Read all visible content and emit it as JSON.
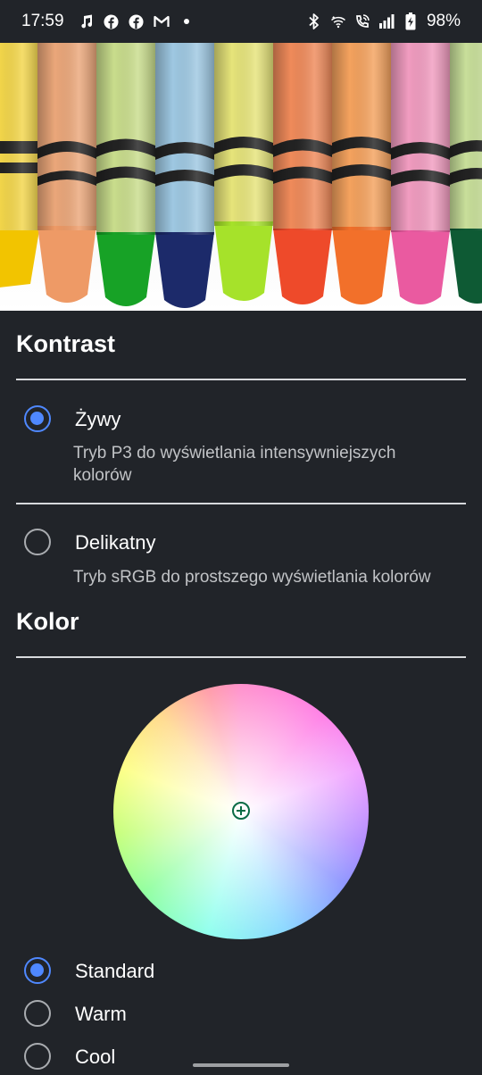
{
  "status_bar": {
    "time": "17:59",
    "left_icons": [
      "music-icon",
      "facebook-icon",
      "facebook-icon",
      "gmail-icon",
      "dot-icon"
    ],
    "right_icons": [
      "bluetooth-icon",
      "wifi-icon",
      "wifi-calling-icon",
      "signal-icon",
      "battery-charging-icon"
    ],
    "battery": "98%"
  },
  "kontrast": {
    "title": "Kontrast",
    "options": [
      {
        "label": "Żywy",
        "description": "Tryb P3 do wyświetlania intensywniejszych kolorów",
        "selected": true
      },
      {
        "label": "Delikatny",
        "description": "Tryb sRGB do prostszego wyświetlania kolorów",
        "selected": false
      }
    ]
  },
  "kolor": {
    "title": "Kolor",
    "wheel_marker": "crosshair-icon",
    "options": [
      {
        "label": "Standard",
        "selected": true
      },
      {
        "label": "Warm",
        "selected": false
      },
      {
        "label": "Cool",
        "selected": false
      }
    ]
  },
  "colors": {
    "background": "#212429",
    "accent": "#4f88ff",
    "marker": "#0a6b46"
  }
}
